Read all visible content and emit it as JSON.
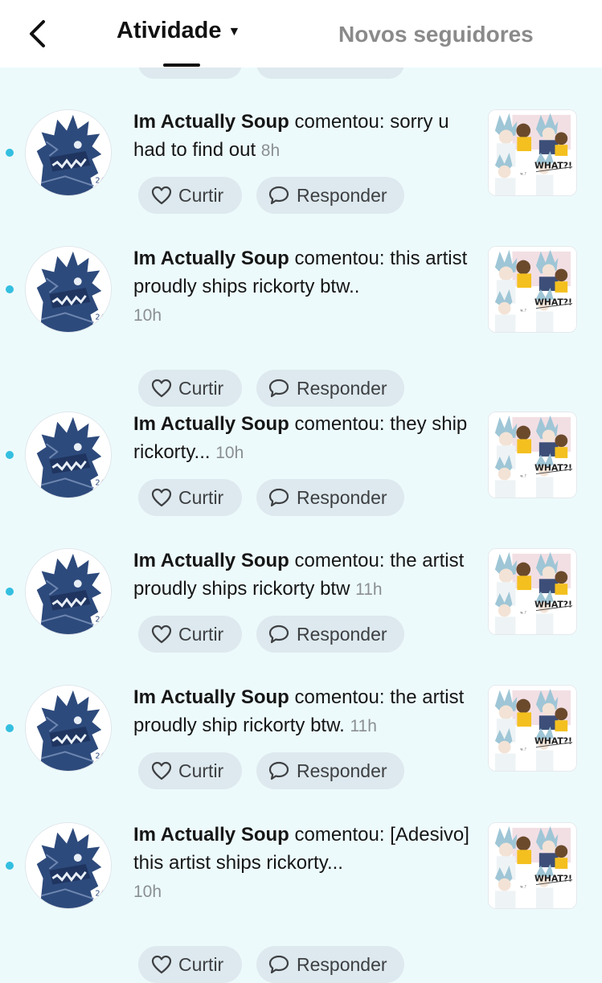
{
  "header": {
    "active_tab": "Atividade",
    "other_tab": "Novos seguidores"
  },
  "items": [
    {
      "name": "Im Actually Soup",
      "text": " comentou: sorry u had to find out ",
      "time": "8h",
      "like_label": "Curtir",
      "reply_label": "Responder"
    },
    {
      "name": "Im Actually Soup",
      "text": " comentou: this artist proudly ships rickorty btw..",
      "time": "10h",
      "like_label": "Curtir",
      "reply_label": "Responder"
    },
    {
      "name": "Im Actually Soup",
      "text": " comentou: they ship rickorty... ",
      "time": "10h",
      "like_label": "Curtir",
      "reply_label": "Responder"
    },
    {
      "name": "Im Actually Soup",
      "text": " comentou: the artist proudly ships rickorty btw ",
      "time": "11h",
      "like_label": "Curtir",
      "reply_label": "Responder"
    },
    {
      "name": "Im Actually Soup",
      "text": " comentou: the artist proudly ship rickorty btw. ",
      "time": "11h",
      "like_label": "Curtir",
      "reply_label": "Responder"
    },
    {
      "name": "Im Actually Soup",
      "text": " comentou: [Adesivo] this artist ships rickorty...",
      "time": "10h",
      "like_label": "Curtir",
      "reply_label": "Responder"
    }
  ],
  "thumbnail_caption": "WHAT?!"
}
